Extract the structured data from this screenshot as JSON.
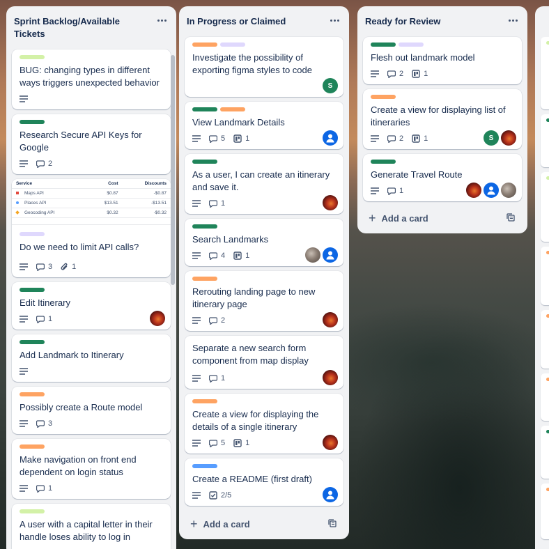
{
  "colors": {
    "green": "#1f845a",
    "orange": "#fea362",
    "purple": "#dfd8fd",
    "lime": "#d3f1a7",
    "blue": "#579dff"
  },
  "lists": [
    {
      "title": "Sprint Backlog/Available Tickets",
      "cards": [
        {
          "labels": [
            "lime"
          ],
          "title": "BUG: changing types in different ways triggers unexpected behavior",
          "description": true
        },
        {
          "labels": [
            "green"
          ],
          "title": "Research Secure API Keys for Google",
          "description": true,
          "comments": "2"
        },
        {
          "labels": [
            "purple"
          ],
          "title": "Do we need to limit API calls?",
          "description": true,
          "comments": "3",
          "attachments": "1",
          "cover_table": {
            "headers": [
              "Service",
              "Cost",
              "Discounts"
            ],
            "rows": [
              [
                "Maps API",
                "$0.87",
                "-$0.87"
              ],
              [
                "Places API",
                "$13.51",
                "-$13.51"
              ],
              [
                "Geocoding API",
                "$0.32",
                "-$0.32"
              ]
            ]
          }
        },
        {
          "labels": [
            "green"
          ],
          "title": "Edit Itinerary",
          "description": true,
          "comments": "1",
          "avatars": [
            "photo"
          ]
        },
        {
          "labels": [
            "green"
          ],
          "title": "Add Landmark to Itinerary",
          "description": true
        },
        {
          "labels": [
            "orange"
          ],
          "title": "Possibly create a Route model",
          "description": true,
          "comments": "3"
        },
        {
          "labels": [
            "orange"
          ],
          "title": "Make navigation on front end dependent on login status",
          "description": true,
          "comments": "1"
        },
        {
          "labels": [
            "lime"
          ],
          "title": "A user with a capital letter in their handle loses ability to log in"
        }
      ]
    },
    {
      "title": "In Progress or Claimed",
      "add_card": "Add a card",
      "cards": [
        {
          "labels": [
            "orange",
            "purple"
          ],
          "title": "Investigate the possibility of exporting figma styles to code",
          "avatars": [
            "green-S"
          ]
        },
        {
          "labels": [
            "green",
            "orange"
          ],
          "title": "View Landmark Details",
          "description": true,
          "comments": "5",
          "checklist_board": "1",
          "avatars": [
            "blue"
          ]
        },
        {
          "labels": [
            "green"
          ],
          "title": "As a user, I can create an itinerary and save it.",
          "description": true,
          "comments": "1",
          "avatars": [
            "photo"
          ]
        },
        {
          "labels": [
            "green"
          ],
          "title": "Search Landmarks",
          "description": true,
          "comments": "4",
          "checklist_board": "1",
          "avatars": [
            "photo2",
            "blue"
          ]
        },
        {
          "labels": [
            "orange"
          ],
          "title": "Rerouting landing page to new itinerary page",
          "description": true,
          "comments": "2",
          "avatars": [
            "photo"
          ]
        },
        {
          "labels": [],
          "title": "Separate a new search form component from map display",
          "description": true,
          "comments": "1",
          "avatars": [
            "photo"
          ]
        },
        {
          "labels": [
            "orange"
          ],
          "title": "Create a view for displaying the details of a single itinerary",
          "description": true,
          "comments": "5",
          "checklist_board": "1",
          "avatars": [
            "photo"
          ]
        },
        {
          "labels": [
            "blue"
          ],
          "title": "Create a README (first draft)",
          "description": true,
          "checklist": "2/5",
          "avatars": [
            "blue"
          ]
        }
      ]
    },
    {
      "title": "Ready for Review",
      "add_card": "Add a card",
      "cards": [
        {
          "labels": [
            "green",
            "purple"
          ],
          "title": "Flesh out landmark model",
          "description": true,
          "comments": "2",
          "checklist_board": "1"
        },
        {
          "labels": [
            "orange"
          ],
          "title": "Create a view for displaying list of itineraries",
          "description": true,
          "comments": "2",
          "checklist_board": "1",
          "avatars": [
            "green-S",
            "photo"
          ]
        },
        {
          "labels": [
            "green"
          ],
          "title": "Generate Travel Route",
          "description": true,
          "comments": "1",
          "avatars": [
            "photo",
            "blue",
            "photo2"
          ]
        }
      ]
    }
  ],
  "avatar_initial": "S"
}
